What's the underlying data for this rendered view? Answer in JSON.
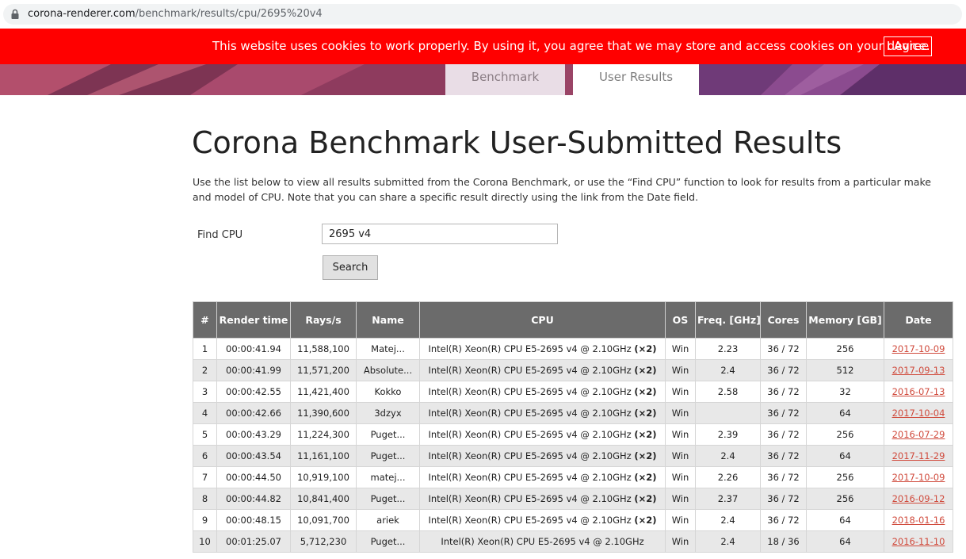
{
  "browser": {
    "url_host": "corona-renderer.com",
    "url_path": "/benchmark/results/cpu/2695%20v4"
  },
  "cookie_banner": {
    "text": "This website uses cookies to work properly. By using it, you agree that we may store and access cookies on your device.",
    "agree_label": "I Agree"
  },
  "nav": {
    "tabs": [
      {
        "label": "Benchmark"
      },
      {
        "label": "User Results"
      }
    ]
  },
  "page": {
    "title": "Corona Benchmark User-Submitted Results",
    "intro": "Use the list below to view all results submitted from the Corona Benchmark, or use the “Find CPU” function to look for results from a particular make and model of CPU. Note that you can share a specific result directly using the link from the Date field."
  },
  "search": {
    "label": "Find CPU",
    "value": "2695 v4",
    "button_label": "Search"
  },
  "table": {
    "headers": [
      "#",
      "Render time",
      "Rays/s",
      "Name",
      "CPU",
      "OS",
      "Freq. [GHz]",
      "Cores",
      "Memory [GB]",
      "Date"
    ],
    "rows": [
      {
        "n": "1",
        "render_time": "00:00:41.94",
        "rays": "11,588,100",
        "name": "Matej...",
        "cpu": "Intel(R) Xeon(R) CPU E5-2695 v4 @ 2.10GHz",
        "multi": "(×2)",
        "os": "Win",
        "freq": "2.23",
        "cores": "36 / 72",
        "memory": "256",
        "date": "2017-10-09"
      },
      {
        "n": "2",
        "render_time": "00:00:41.99",
        "rays": "11,571,200",
        "name": "Absolute...",
        "cpu": "Intel(R) Xeon(R) CPU E5-2695 v4 @ 2.10GHz",
        "multi": "(×2)",
        "os": "Win",
        "freq": "2.4",
        "cores": "36 / 72",
        "memory": "512",
        "date": "2017-09-13"
      },
      {
        "n": "3",
        "render_time": "00:00:42.55",
        "rays": "11,421,400",
        "name": "Kokko",
        "cpu": "Intel(R) Xeon(R) CPU E5-2695 v4 @ 2.10GHz",
        "multi": "(×2)",
        "os": "Win",
        "freq": "2.58",
        "cores": "36 / 72",
        "memory": "32",
        "date": "2016-07-13"
      },
      {
        "n": "4",
        "render_time": "00:00:42.66",
        "rays": "11,390,600",
        "name": "3dzyx",
        "cpu": "Intel(R) Xeon(R) CPU E5-2695 v4 @ 2.10GHz",
        "multi": "(×2)",
        "os": "Win",
        "freq": "",
        "cores": "36 / 72",
        "memory": "64",
        "date": "2017-10-04"
      },
      {
        "n": "5",
        "render_time": "00:00:43.29",
        "rays": "11,224,300",
        "name": "Puget...",
        "cpu": "Intel(R) Xeon(R) CPU E5-2695 v4 @ 2.10GHz",
        "multi": "(×2)",
        "os": "Win",
        "freq": "2.39",
        "cores": "36 / 72",
        "memory": "256",
        "date": "2016-07-29"
      },
      {
        "n": "6",
        "render_time": "00:00:43.54",
        "rays": "11,161,100",
        "name": "Puget...",
        "cpu": "Intel(R) Xeon(R) CPU E5-2695 v4 @ 2.10GHz",
        "multi": "(×2)",
        "os": "Win",
        "freq": "2.4",
        "cores": "36 / 72",
        "memory": "64",
        "date": "2017-11-29"
      },
      {
        "n": "7",
        "render_time": "00:00:44.50",
        "rays": "10,919,100",
        "name": "matej...",
        "cpu": "Intel(R) Xeon(R) CPU E5-2695 v4 @ 2.10GHz",
        "multi": "(×2)",
        "os": "Win",
        "freq": "2.26",
        "cores": "36 / 72",
        "memory": "256",
        "date": "2017-10-09"
      },
      {
        "n": "8",
        "render_time": "00:00:44.82",
        "rays": "10,841,400",
        "name": "Puget...",
        "cpu": "Intel(R) Xeon(R) CPU E5-2695 v4 @ 2.10GHz",
        "multi": "(×2)",
        "os": "Win",
        "freq": "2.37",
        "cores": "36 / 72",
        "memory": "256",
        "date": "2016-09-12"
      },
      {
        "n": "9",
        "render_time": "00:00:48.15",
        "rays": "10,091,700",
        "name": "ariek",
        "cpu": "Intel(R) Xeon(R) CPU E5-2695 v4 @ 2.10GHz",
        "multi": "(×2)",
        "os": "Win",
        "freq": "2.4",
        "cores": "36 / 72",
        "memory": "64",
        "date": "2018-01-16"
      },
      {
        "n": "10",
        "render_time": "00:01:25.07",
        "rays": "5,712,230",
        "name": "Puget...",
        "cpu": "Intel(R) Xeon(R) CPU E5-2695 v4 @ 2.10GHz",
        "multi": "",
        "os": "Win",
        "freq": "2.4",
        "cores": "18 / 36",
        "memory": "64",
        "date": "2016-11-10"
      }
    ]
  },
  "colors": {
    "cookie_bg": "#ff0000",
    "table_header_bg": "#6b6b6b",
    "row_alt_bg": "#e8e8e8",
    "date_link": "#d04a3c"
  }
}
